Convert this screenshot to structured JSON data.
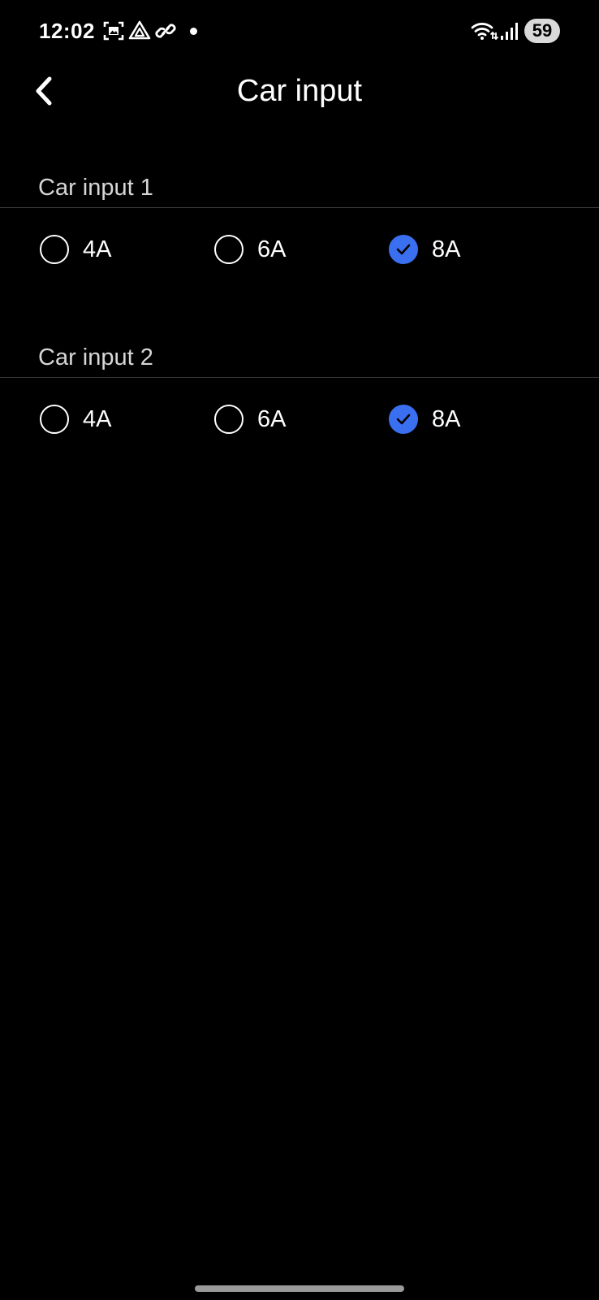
{
  "status_bar": {
    "time": "12:02",
    "battery": "59",
    "icons": [
      "screenshot-icon",
      "drive-icon",
      "link-icon",
      "notification-dot",
      "wifi-icon",
      "signal-icon"
    ]
  },
  "header": {
    "title": "Car input",
    "back_icon": "chevron-left-icon"
  },
  "sections": [
    {
      "label": "Car input 1",
      "options": [
        {
          "label": "4A",
          "selected": false
        },
        {
          "label": "6A",
          "selected": false
        },
        {
          "label": "8A",
          "selected": true
        }
      ]
    },
    {
      "label": "Car input 2",
      "options": [
        {
          "label": "4A",
          "selected": false
        },
        {
          "label": "6A",
          "selected": false
        },
        {
          "label": "8A",
          "selected": true
        }
      ]
    }
  ],
  "colors": {
    "background": "#000000",
    "accent": "#3a6ff0",
    "text": "#ffffff",
    "section_label": "#d6d6d6"
  }
}
